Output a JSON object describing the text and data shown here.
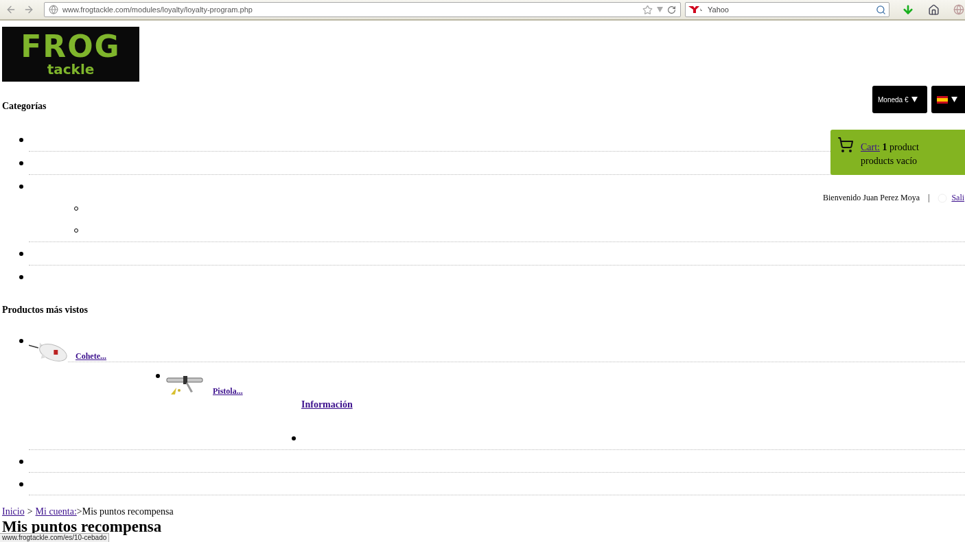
{
  "browser": {
    "url": "www.frogtackle.com/modules/loyalty/loyalty-program.php",
    "search": {
      "placeholder": "Yahoo"
    }
  },
  "logo": {
    "line_1": "FROG",
    "line_2": "tackle"
  },
  "currency": {
    "label": "Moneda €"
  },
  "cart": {
    "link": "Cart:",
    "count": "**1** product",
    "status": "products vacío"
  },
  "user": {
    "welcome": "Bienvenido Juan Perez Moya",
    "separator": "|",
    "logout": "Sali"
  },
  "categories": {
    "title": "Categorías",
    "items": [
      {
        "kind": "disc"
      },
      {
        "kind": "disc"
      },
      {
        "kind": "disc",
        "children": [
          {
            "kind": "circle"
          },
          {
            "kind": "circle"
          }
        ]
      },
      {
        "kind": "disc"
      },
      {
        "kind": "disc"
      }
    ]
  },
  "most_viewed": {
    "title": "Productos más vistos",
    "products": [
      {
        "name": "Cohete...",
        "kind": "picture"
      },
      {
        "name": "Pistola...",
        "kind": "picture"
      }
    ],
    "info_link": "Información",
    "info_items": [
      {
        "kind": "disc"
      }
    ],
    "extra_items": [
      {
        "kind": "disc"
      },
      {
        "kind": "disc"
      }
    ]
  },
  "breadcrumb": [
    {
      "label": "Inicio",
      "kind": "link"
    },
    {
      "label": ">",
      "kind": "text"
    },
    {
      "label": "Mi cuenta:",
      "kind": "link"
    },
    {
      "label": ">Mis puntos recompensa",
      "kind": "text"
    }
  ],
  "page_title": "Mis puntos recompensa",
  "status_link": "www.frogtackle.com/es/10-cebado"
}
